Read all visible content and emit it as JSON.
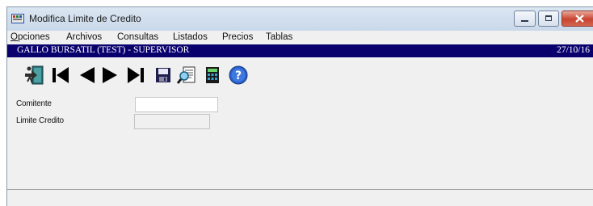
{
  "window": {
    "title": "Modifica Limite de Credito",
    "icon": "app-icon"
  },
  "menu": {
    "items": [
      {
        "mnemonic": "O",
        "rest": "pciones"
      },
      {
        "mnemonic": "",
        "rest": "Archivos"
      },
      {
        "mnemonic": "",
        "rest": "Consultas"
      },
      {
        "mnemonic": "",
        "rest": "Listados"
      },
      {
        "mnemonic": "",
        "rest": "Precios"
      },
      {
        "mnemonic": "",
        "rest": "Tablas"
      }
    ]
  },
  "status": {
    "session": "GALLO BURSATIL (TEST) - SUPERVISOR",
    "date": "27/10/16",
    "background": "#09006e"
  },
  "toolbar": {
    "buttons": [
      "exit-door-icon",
      "first-record-icon",
      "previous-record-icon",
      "next-record-icon",
      "last-record-icon",
      "save-icon",
      "search-document-icon",
      "calculator-icon",
      "help-icon"
    ]
  },
  "form": {
    "comitente_label": "Comitente",
    "comitente_value": "",
    "limite_label": "Limite Credito",
    "limite_value": ""
  }
}
